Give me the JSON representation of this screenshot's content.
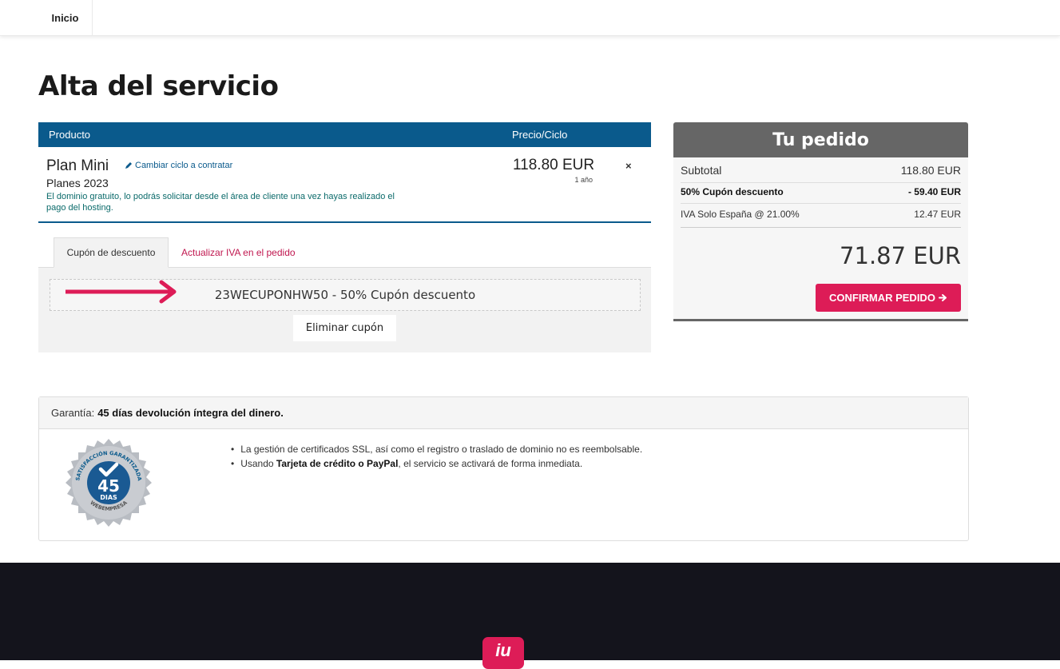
{
  "nav": {
    "home": "Inicio"
  },
  "page": {
    "title": "Alta del servicio"
  },
  "product_table": {
    "col_product": "Producto",
    "col_price": "Precio/Ciclo",
    "item": {
      "name": "Plan Mini",
      "change_cycle": "Cambiar ciclo a contratar",
      "group": "Planes 2023",
      "note": "El dominio gratuito, lo podrás solicitar desde el área de cliente una vez hayas realizado el pago del hosting.",
      "price": "118.80 EUR",
      "cycle": "1 año",
      "remove": "×"
    }
  },
  "tabs": {
    "coupon": "Cupón de descuento",
    "vat": "Actualizar IVA en el pedido"
  },
  "coupon": {
    "applied": "23WECUPONHW50 - 50% Cupón descuento",
    "remove_label": "Eliminar cupón",
    "arrow_color": "#dd1c57"
  },
  "order": {
    "title": "Tu pedido",
    "subtotal_label": "Subtotal",
    "subtotal_value": "118.80 EUR",
    "discount_label": "50% Cupón descuento",
    "discount_value": "- 59.40 EUR",
    "tax_label": "IVA Solo España @ 21.00%",
    "tax_value": "12.47 EUR",
    "total": "71.87 EUR",
    "confirm_label": "CONFIRMAR PEDIDO",
    "confirm_icon": "arrow-right-icon"
  },
  "guarantee": {
    "prefix": "Garantía:",
    "highlight": "45 días devolución íntegra del dinero.",
    "seal": {
      "top": "SATISFACCIÓN GARANTIZADA",
      "number": "45",
      "unit": "DIAS",
      "bottom": "WEBEMPRESA"
    },
    "items": [
      {
        "text": "La gestión de certificados SSL, así como el registro o traslado de dominio no es reembolsable."
      },
      {
        "pre": "Usando ",
        "bold": "Tarjeta de crédito o PayPal",
        "post": ", el servicio se activará de forma inmediata."
      }
    ]
  },
  "footer": {
    "logo": "iu"
  },
  "colors": {
    "brand_blue": "#0a5a8c",
    "accent": "#dd1c57",
    "dark": "#14141c"
  }
}
